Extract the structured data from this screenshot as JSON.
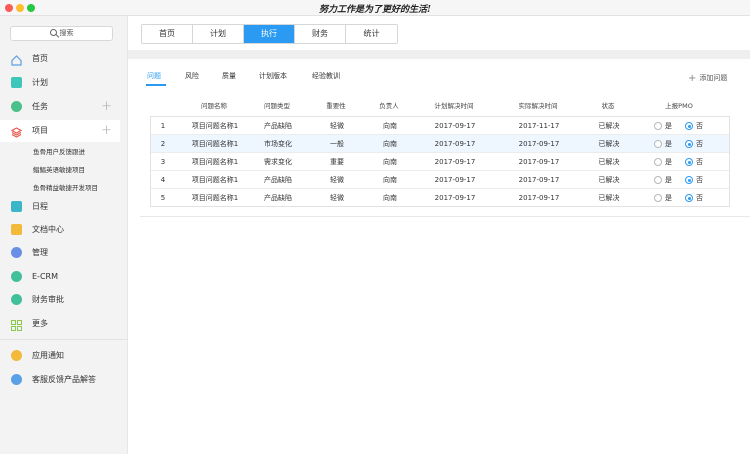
{
  "window": {
    "title": "努力工作是为了更好的生活!"
  },
  "sidebar": {
    "search_label": "搜索",
    "items": [
      {
        "label": "首页",
        "icon": "home-icon",
        "color": "#5aa0e6"
      },
      {
        "label": "计划",
        "icon": "plan-icon",
        "color": "#3ec7b8"
      },
      {
        "label": "任务",
        "icon": "task-icon",
        "color": "#4cc08a"
      },
      {
        "label": "项目",
        "icon": "project-icon",
        "color": "#e8564a"
      },
      {
        "label": "日程",
        "icon": "calendar-icon",
        "color": "#3bb5c8"
      },
      {
        "label": "文档中心",
        "icon": "document-icon",
        "color": "#f2b93b"
      },
      {
        "label": "管理",
        "icon": "manage-icon",
        "color": "#6a8fe6"
      },
      {
        "label": "E-CRM",
        "icon": "crm-icon",
        "color": "#42c09a"
      },
      {
        "label": "财务审批",
        "icon": "finance-icon",
        "color": "#42c09a"
      },
      {
        "label": "更多",
        "icon": "grid-icon",
        "color": "#8cc84b"
      },
      {
        "label": "应用通知",
        "icon": "notify-icon",
        "color": "#f2b93b"
      },
      {
        "label": "客服反馈产品解答",
        "icon": "support-icon",
        "color": "#5aa0e6"
      }
    ],
    "project_subitems": [
      "鱼骨用户反馈跟进",
      "鲳鲳英语敏捷项目",
      "鱼骨精益敏捷开发项目"
    ]
  },
  "tabs": [
    "首页",
    "计划",
    "执行",
    "财务",
    "统计"
  ],
  "active_tab": "执行",
  "subtabs": [
    "问题",
    "风险",
    "质量",
    "计划版本",
    "经验教训"
  ],
  "active_subtab": "问题",
  "add_issue_label": "添加问题",
  "table": {
    "headers": [
      "问题名称",
      "问题类型",
      "重要性",
      "负责人",
      "计划解决时间",
      "实际解决时间",
      "状态",
      "上报PMO"
    ],
    "yes_label": "是",
    "no_label": "否",
    "rows": [
      {
        "no": "1",
        "name": "项目问题名称1",
        "type": "产品缺陷",
        "importance": "轻微",
        "owner": "向南",
        "planned": "2017-09-17",
        "actual": "2017-11-17",
        "status": "已解决",
        "pmo": "否"
      },
      {
        "no": "2",
        "name": "项目问题名称1",
        "type": "市场变化",
        "importance": "一般",
        "owner": "向南",
        "planned": "2017-09-17",
        "actual": "2017-09-17",
        "status": "已解决",
        "pmo": "否"
      },
      {
        "no": "3",
        "name": "项目问题名称1",
        "type": "需求变化",
        "importance": "重要",
        "owner": "向南",
        "planned": "2017-09-17",
        "actual": "2017-09-17",
        "status": "已解决",
        "pmo": "否"
      },
      {
        "no": "4",
        "name": "项目问题名称1",
        "type": "产品缺陷",
        "importance": "轻微",
        "owner": "向南",
        "planned": "2017-09-17",
        "actual": "2017-09-17",
        "status": "已解决",
        "pmo": "否"
      },
      {
        "no": "5",
        "name": "项目问题名称1",
        "type": "产品缺陷",
        "importance": "轻微",
        "owner": "向南",
        "planned": "2017-09-17",
        "actual": "2017-09-17",
        "status": "已解决",
        "pmo": "否"
      }
    ]
  },
  "colors": {
    "accent": "#2b9af3"
  }
}
